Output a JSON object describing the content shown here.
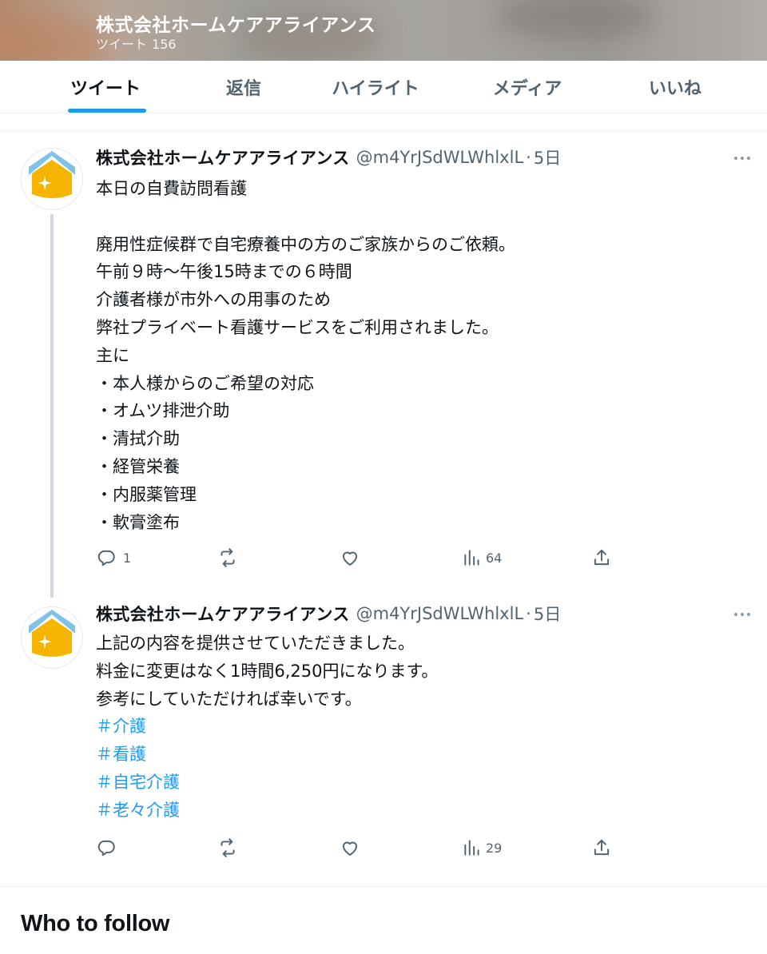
{
  "header": {
    "title": "株式会社ホームケアアライアンス",
    "tweet_label": "ツイート",
    "tweet_count": "156"
  },
  "tabs": [
    {
      "label": "ツイート",
      "active": true
    },
    {
      "label": "返信",
      "active": false
    },
    {
      "label": "ハイライト",
      "active": false
    },
    {
      "label": "メディア",
      "active": false
    },
    {
      "label": "いいね",
      "active": false
    }
  ],
  "tweets": [
    {
      "name": "株式会社ホームケアアライアンス",
      "handle": "@m4YrJSdWLWhlxlL",
      "separator": "·",
      "time": "5日",
      "lines": [
        "本日の自費訪問看護",
        "",
        "廃用性症候群で自宅療養中の方のご家族からのご依頼。",
        "午前９時〜午後15時までの６時間",
        "介護者様が市外への用事のため",
        "弊社プライベート看護サービスをご利用されました。",
        "主に",
        "・本人様からのご希望の対応",
        "・オムツ排泄介助",
        "・清拭介助",
        "・経管栄養",
        "・内服薬管理",
        "・軟膏塗布"
      ],
      "hashtags": [],
      "replies": "1",
      "retweets": "",
      "likes": "",
      "views": "64"
    },
    {
      "name": "株式会社ホームケアアライアンス",
      "handle": "@m4YrJSdWLWhlxlL",
      "separator": "·",
      "time": "5日",
      "lines": [
        "上記の内容を提供させていただきました。",
        "料金に変更はなく1時間6,250円になります。",
        "参考にしていただければ幸いです。"
      ],
      "hashtags": [
        "＃介護",
        "＃看護",
        "＃自宅介護",
        "＃老々介護"
      ],
      "replies": "",
      "retweets": "",
      "likes": "",
      "views": "29"
    }
  ],
  "who_to_follow": "Who to follow",
  "colors": {
    "accent": "#1d9bf0",
    "secondary_text": "#536471",
    "avatar_yellow": "#f4b400",
    "avatar_sky": "#7ec3e6"
  }
}
